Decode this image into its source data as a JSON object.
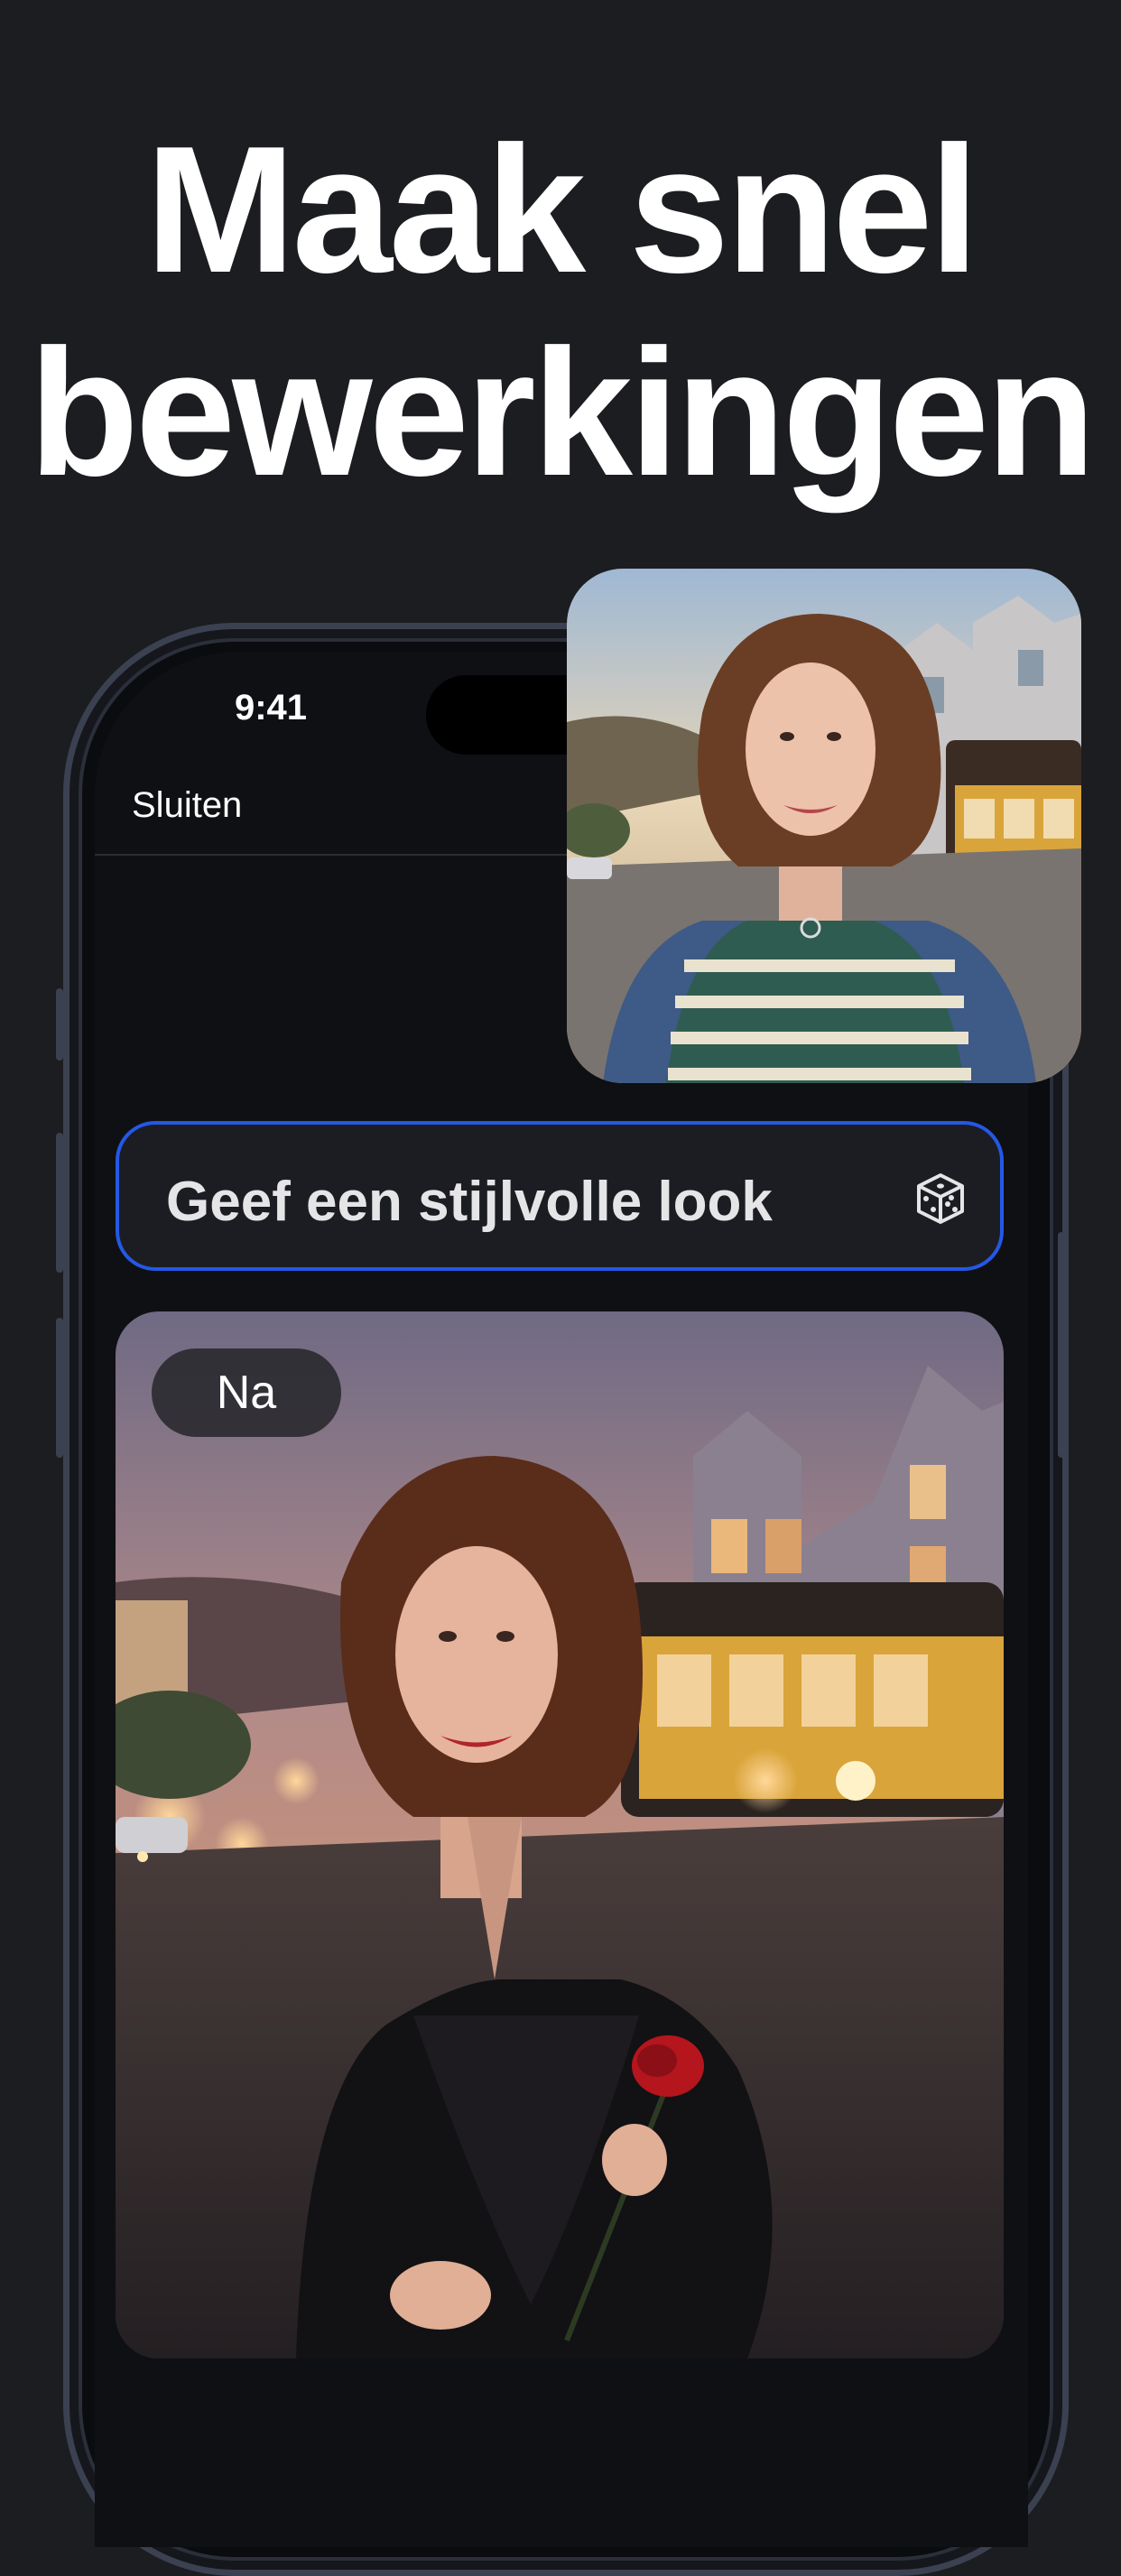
{
  "headline": {
    "line1": "Maak snel",
    "line2": "bewerkingen"
  },
  "status_bar": {
    "time": "9:41"
  },
  "nav": {
    "close_label": "Sluiten"
  },
  "prompt": {
    "text": "Geef een stijlvolle look",
    "randomize_icon": "dice-icon"
  },
  "after_image": {
    "badge": "Na"
  },
  "colors": {
    "background": "#1c1d20",
    "accent_border": "#2458e6",
    "text": "#ffffff"
  }
}
